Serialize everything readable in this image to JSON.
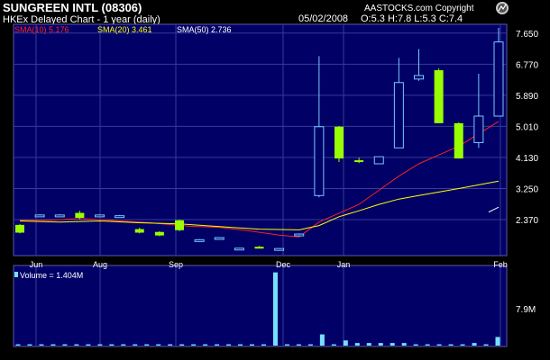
{
  "header": {
    "title": "SUNGREEN INTL (08306)",
    "subtitle": "HKEx  Delayed Chart - 1 year (daily)",
    "copyright": "AASTOCKS.com Copyright",
    "date": "05/02/2008",
    "ohlc": "O:5.3  H:7.8  L:5.3  C:7.4"
  },
  "colors": {
    "background": "#000000",
    "panel": "#000066",
    "grid": "#3a3a9a",
    "up_candle": "#78c8ff",
    "down_candle": "#99ff00",
    "sma10": "#ff2020",
    "sma20": "#ffff00",
    "sma50": "#ffffff",
    "volume": "#78e0ff",
    "text": "#ffffff"
  },
  "chart_data": {
    "type": "candlestick",
    "x_ticks": [
      "Jun",
      "Aug",
      "Sep",
      "Dec",
      "Jan",
      "Feb"
    ],
    "y_ticks": [
      "7.650",
      "6.770",
      "5.890",
      "5.010",
      "4.130",
      "3.250",
      "2.370"
    ],
    "ylim": [
      1.35,
      7.9
    ],
    "legend": [
      {
        "label": "SMA(10)",
        "value": "5.176",
        "color_key": "sma10"
      },
      {
        "label": "SMA(20)",
        "value": "3.461",
        "color_key": "sma20"
      },
      {
        "label": "SMA(50)",
        "value": "2.736",
        "color_key": "sma50"
      }
    ],
    "candles": [
      {
        "x": 0,
        "o": 2.22,
        "h": 2.24,
        "l": 1.98,
        "c": 2.0
      },
      {
        "x": 1,
        "o": 2.48,
        "h": 2.52,
        "l": 2.44,
        "c": 2.5
      },
      {
        "x": 2,
        "o": 2.48,
        "h": 2.52,
        "l": 2.44,
        "c": 2.5
      },
      {
        "x": 3,
        "o": 2.56,
        "h": 2.62,
        "l": 2.38,
        "c": 2.42
      },
      {
        "x": 4,
        "o": 2.48,
        "h": 2.52,
        "l": 2.44,
        "c": 2.5
      },
      {
        "x": 5,
        "o": 2.46,
        "h": 2.5,
        "l": 2.42,
        "c": 2.48
      },
      {
        "x": 6,
        "o": 2.1,
        "h": 2.14,
        "l": 1.98,
        "c": 2.0
      },
      {
        "x": 7,
        "o": 2.02,
        "h": 2.04,
        "l": 1.9,
        "c": 1.92
      },
      {
        "x": 8,
        "o": 2.35,
        "h": 2.37,
        "l": 2.04,
        "c": 2.07
      },
      {
        "x": 9,
        "o": 1.8,
        "h": 1.82,
        "l": 1.78,
        "c": 1.8
      },
      {
        "x": 10,
        "o": 1.84,
        "h": 1.86,
        "l": 1.82,
        "c": 1.86
      },
      {
        "x": 11,
        "o": 1.55,
        "h": 1.57,
        "l": 1.52,
        "c": 1.56
      },
      {
        "x": 12,
        "o": 1.6,
        "h": 1.62,
        "l": 1.56,
        "c": 1.58
      },
      {
        "x": 13,
        "o": 1.54,
        "h": 1.56,
        "l": 1.52,
        "c": 1.55
      },
      {
        "x": 14,
        "o": 1.93,
        "h": 1.98,
        "l": 1.92,
        "c": 1.96
      },
      {
        "x": 15,
        "o": 3.05,
        "h": 7.0,
        "l": 3.0,
        "c": 5.0
      },
      {
        "x": 16,
        "o": 5.0,
        "h": 5.02,
        "l": 4.0,
        "c": 4.1
      },
      {
        "x": 17,
        "o": 4.05,
        "h": 4.12,
        "l": 3.97,
        "c": 4.0
      },
      {
        "x": 18,
        "o": 3.95,
        "h": 4.15,
        "l": 3.95,
        "c": 4.15
      },
      {
        "x": 19,
        "o": 4.4,
        "h": 6.95,
        "l": 4.4,
        "c": 6.25
      },
      {
        "x": 20,
        "o": 6.35,
        "h": 7.2,
        "l": 6.3,
        "c": 6.45
      },
      {
        "x": 21,
        "o": 6.6,
        "h": 6.65,
        "l": 5.1,
        "c": 5.1
      },
      {
        "x": 22,
        "o": 5.1,
        "h": 5.12,
        "l": 4.1,
        "c": 4.1
      },
      {
        "x": 23,
        "o": 4.55,
        "h": 6.5,
        "l": 4.4,
        "c": 5.3
      },
      {
        "x": 24,
        "o": 5.3,
        "h": 7.8,
        "l": 5.3,
        "c": 7.4
      }
    ],
    "sma10": [
      [
        0,
        2.35
      ],
      [
        1.5,
        2.35
      ],
      [
        3,
        2.4
      ],
      [
        4.5,
        2.35
      ],
      [
        6.5,
        2.28
      ],
      [
        8.5,
        2.18
      ],
      [
        10,
        2.15
      ],
      [
        11.5,
        2.05
      ],
      [
        13,
        1.93
      ],
      [
        14,
        1.88
      ],
      [
        15,
        2.3
      ],
      [
        16,
        2.55
      ],
      [
        17,
        2.8
      ],
      [
        18,
        3.2
      ],
      [
        19,
        3.6
      ],
      [
        20,
        3.95
      ],
      [
        21,
        4.2
      ],
      [
        22,
        4.45
      ],
      [
        24,
        5.15
      ]
    ],
    "sma20": [
      [
        0,
        2.33
      ],
      [
        2,
        2.3
      ],
      [
        4,
        2.33
      ],
      [
        6,
        2.28
      ],
      [
        8,
        2.25
      ],
      [
        10,
        2.17
      ],
      [
        12,
        2.1
      ],
      [
        14,
        2.08
      ],
      [
        15,
        2.2
      ],
      [
        16,
        2.45
      ],
      [
        17,
        2.62
      ],
      [
        18,
        2.8
      ],
      [
        19,
        2.95
      ],
      [
        20,
        3.05
      ],
      [
        22,
        3.25
      ],
      [
        24,
        3.46
      ]
    ],
    "sma50": [
      [
        23.5,
        2.58
      ],
      [
        24,
        2.72
      ]
    ],
    "volume": {
      "label": "Volume = 1.404M",
      "tick": "7.9M",
      "ymax": 9.3,
      "values": [
        0.15,
        0.15,
        0.15,
        0.15,
        0.15,
        0.15,
        0.15,
        0.15,
        0.15,
        0.15,
        0.15,
        0.15,
        0.15,
        0.15,
        0.15,
        0.15,
        0.15,
        0.15,
        0.15,
        0.15,
        0.15,
        0.15,
        8.5,
        0.15,
        0.15,
        0.15,
        1.3,
        0.15,
        0.6,
        0.3,
        0.3,
        0.3,
        0.3,
        0.3,
        0.15,
        0.15,
        0.15,
        0.15,
        0.15,
        0.3,
        0.15,
        1.0
      ]
    }
  }
}
